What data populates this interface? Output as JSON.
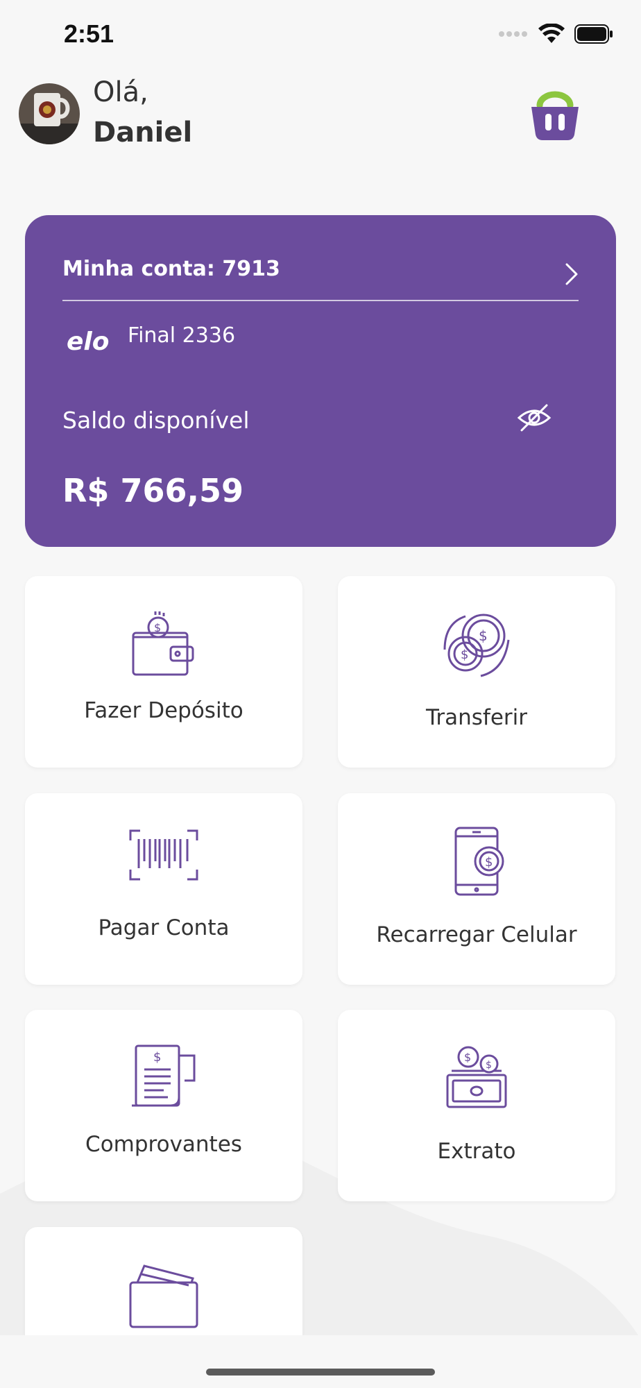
{
  "status_bar": {
    "time": "2:51",
    "icons": [
      "signal-icon",
      "wifi-icon",
      "battery-icon"
    ]
  },
  "header": {
    "greeting": "Olá,",
    "user_name": "Daniel",
    "basket_icon": "shopping-basket-icon"
  },
  "account": {
    "label": "Minha conta: 7913",
    "card_brand": "elo",
    "card_final": "Final 2336",
    "balance_label": "Saldo disponível",
    "balance_value": "R$ 766,59"
  },
  "actions": [
    {
      "label": "Fazer Depósito",
      "icon": "wallet-deposit-icon"
    },
    {
      "label": "Transferir",
      "icon": "coins-transfer-icon"
    },
    {
      "label": "Pagar Conta",
      "icon": "barcode-icon"
    },
    {
      "label": "Recarregar Celular",
      "icon": "phone-recharge-icon"
    },
    {
      "label": "Comprovantes",
      "icon": "receipt-icon"
    },
    {
      "label": "Extrato",
      "icon": "statement-cash-icon"
    },
    {
      "label": "",
      "icon": "cards-wallet-icon"
    }
  ],
  "colors": {
    "brand_purple": "#6b4c9d",
    "accent_green": "#8cc63f",
    "background": "#f7f7f7"
  }
}
